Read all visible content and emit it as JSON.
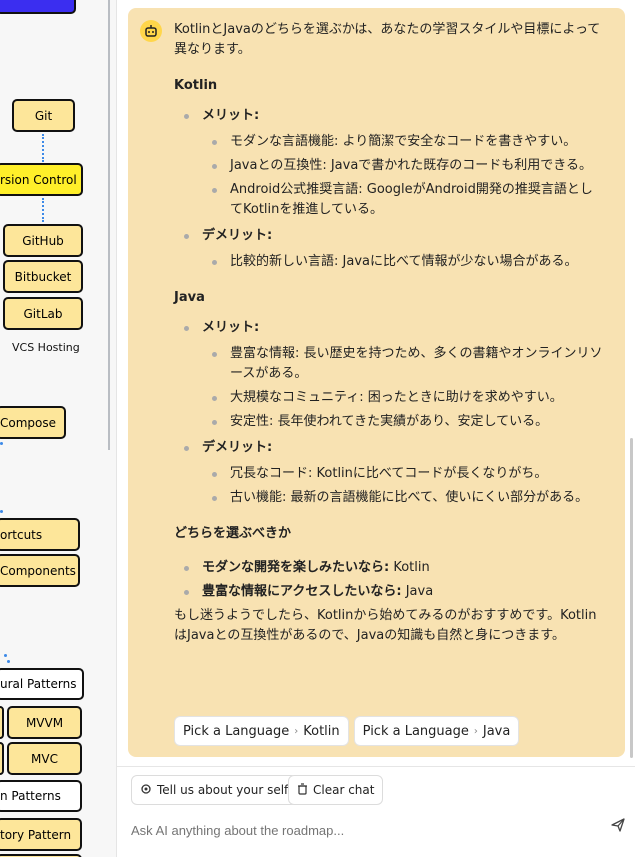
{
  "roadmap": {
    "nodes": {
      "git": "Git",
      "version_control": "rsion Control",
      "github": "GitHub",
      "bitbucket": "Bitbucket",
      "gitlab": "GitLab",
      "vcs_hosting": "VCS Hosting",
      "compose": "Compose",
      "shortcuts": "ortcuts",
      "components": "Components",
      "architectural_patterns": "ural Patterns",
      "mvvm": "MVVM",
      "mvc": "MVC",
      "design_patterns": "n Patterns",
      "factory_pattern": "tory Pattern"
    }
  },
  "chat": {
    "intro": "KotlinとJavaのどちらを選ぶかは、あなたの学習スタイルや目標によって異なります。",
    "kotlin": {
      "title": "Kotlin",
      "pros_label": "メリット:",
      "pros": [
        "モダンな言語機能: より簡潔で安全なコードを書きやすい。",
        "Javaとの互換性: Javaで書かれた既存のコードも利用できる。",
        "Android公式推奨言語: GoogleがAndroid開発の推奨言語としてKotlinを推進している。"
      ],
      "cons_label": "デメリット:",
      "cons": [
        "比較的新しい言語: Javaに比べて情報が少ない場合がある。"
      ]
    },
    "java": {
      "title": "Java",
      "pros_label": "メリット:",
      "pros": [
        "豊富な情報: 長い歴史を持つため、多くの書籍やオンラインリソースがある。",
        "大規模なコミュニティ: 困ったときに助けを求めやすい。",
        "安定性: 長年使われてきた実績があり、安定している。"
      ],
      "cons_label": "デメリット:",
      "cons": [
        "冗長なコード: Kotlinに比べてコードが長くなりがち。",
        "古い機能: 最新の言語機能に比べて、使いにくい部分がある。"
      ]
    },
    "choose_title": "どちらを選ぶべきか",
    "recommendations": [
      {
        "label": "モダンな開発を楽しみたいなら:",
        "value": "Kotlin"
      },
      {
        "label": "豊富な情報にアクセスしたいなら:",
        "value": "Java"
      }
    ],
    "closing": "もし迷うようでしたら、Kotlinから始めてみるのがおすすめです。KotlinはJavaとの互換性があるので、Javaの知識も自然と身につきます。",
    "chips": [
      {
        "left": "Pick a Language",
        "right": "Kotlin"
      },
      {
        "left": "Pick a Language",
        "right": "Java"
      }
    ]
  },
  "footer": {
    "tell_button": "Tell us about your self",
    "clear_button": "Clear chat",
    "input_placeholder": "Ask AI anything about the roadmap..."
  },
  "colors": {
    "bubble_bg": "#f8e2b2",
    "node_fill": "#fde69a",
    "node_highlight": "#ffef2a",
    "bot_icon": "#ffd64a",
    "connector": "#3d8ae8"
  },
  "icons": [
    "bot-icon",
    "gear-icon",
    "trash-icon",
    "send-icon",
    "chevron-right-icon"
  ]
}
